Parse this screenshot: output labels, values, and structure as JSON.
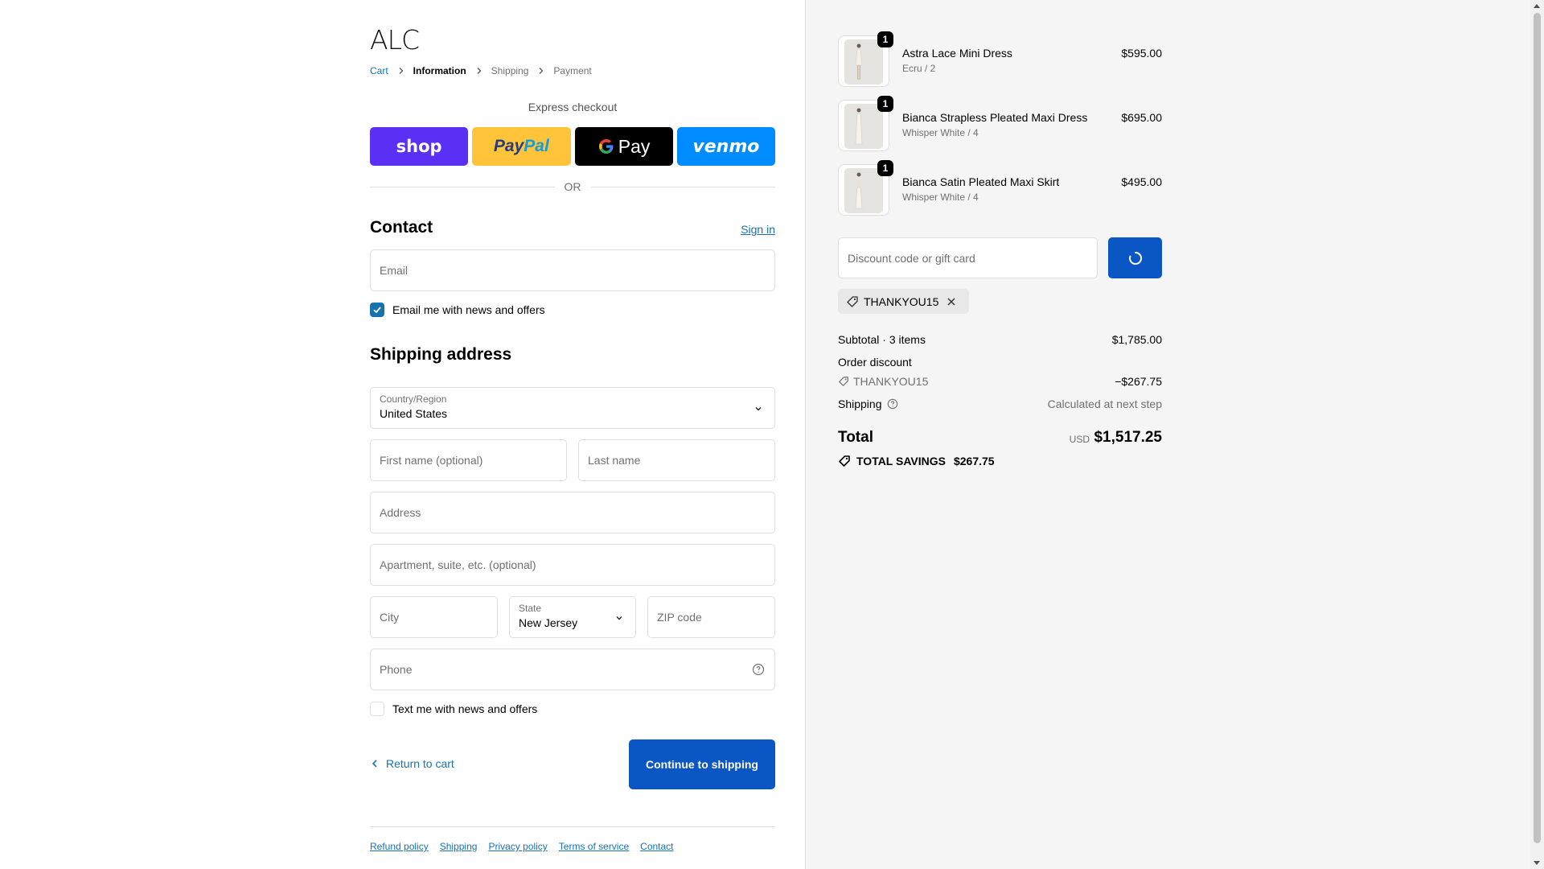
{
  "brand": {
    "logo": "ALC"
  },
  "breadcrumb": {
    "cart": "Cart",
    "information": "Information",
    "shipping": "Shipping",
    "payment": "Payment"
  },
  "express": {
    "title": "Express checkout",
    "shop": "shop",
    "paypal_a": "Pay",
    "paypal_b": "Pal",
    "gpay": "Pay",
    "venmo": "venmo"
  },
  "divider": {
    "or": "OR"
  },
  "contact": {
    "title": "Contact",
    "sign_in": "Sign in",
    "email_placeholder": "Email",
    "newsletter_label": "Email me with news and offers",
    "newsletter_checked": true
  },
  "shipping_address": {
    "title": "Shipping address",
    "country_label": "Country/Region",
    "country_value": "United States",
    "first_name_placeholder": "First name (optional)",
    "last_name_placeholder": "Last name",
    "address_placeholder": "Address",
    "apartment_placeholder": "Apartment, suite, etc. (optional)",
    "city_placeholder": "City",
    "state_label": "State",
    "state_value": "New Jersey",
    "zip_placeholder": "ZIP code",
    "phone_placeholder": "Phone",
    "sms_label": "Text me with news and offers",
    "sms_checked": false
  },
  "actions": {
    "return": "Return to cart",
    "continue": "Continue to shipping"
  },
  "footer": {
    "links": [
      "Refund policy",
      "Shipping",
      "Privacy policy",
      "Terms of service",
      "Contact"
    ]
  },
  "order": {
    "items": [
      {
        "qty": "1",
        "name": "Astra Lace Mini Dress",
        "variant": "Ecru / 2",
        "price": "$595.00"
      },
      {
        "qty": "1",
        "name": "Bianca Strapless Pleated Maxi Dress",
        "variant": "Whisper White / 4",
        "price": "$695.00"
      },
      {
        "qty": "1",
        "name": "Bianca Satin Pleated Maxi Skirt",
        "variant": "Whisper White / 4",
        "price": "$495.00"
      }
    ],
    "discount_placeholder": "Discount code or gift card",
    "applied_code": "THANKYOU15",
    "subtotal_label": "Subtotal · 3 items",
    "subtotal_value": "$1,785.00",
    "order_discount_label": "Order discount",
    "discount_code": "THANKYOU15",
    "discount_value": "−$267.75",
    "shipping_label": "Shipping",
    "shipping_value": "Calculated at next step",
    "total_label": "Total",
    "currency": "USD",
    "total_value": "$1,517.25",
    "savings_label": "TOTAL SAVINGS",
    "savings_value": "$267.75"
  },
  "colors": {
    "accent": "#0b56c5",
    "link": "#1773b0",
    "shop": "#5a31f4",
    "paypal": "#ffc439",
    "venmo": "#008cff"
  }
}
